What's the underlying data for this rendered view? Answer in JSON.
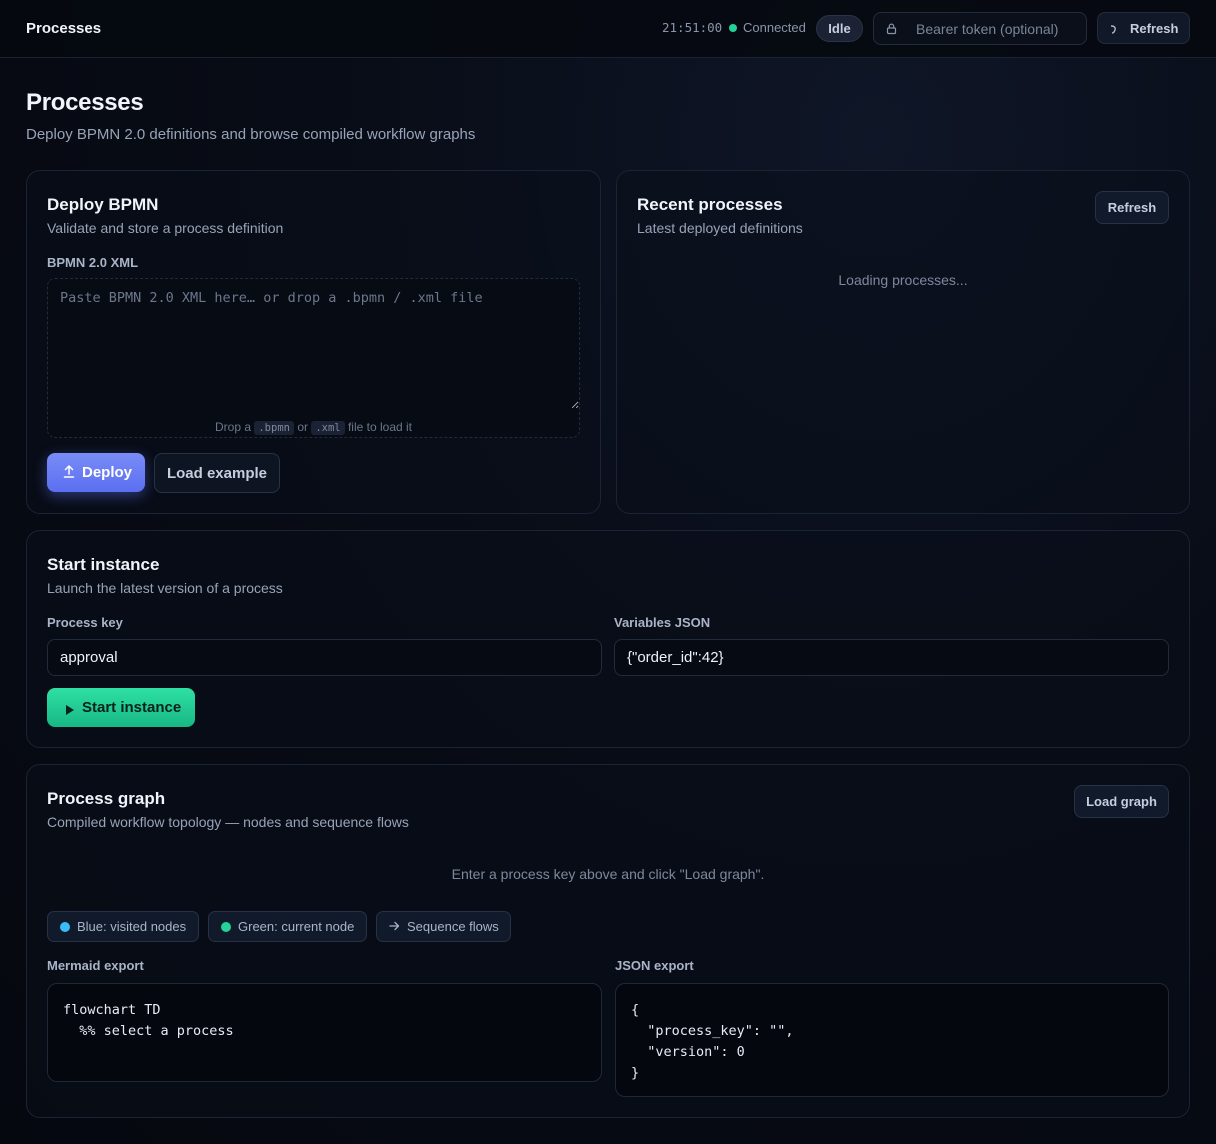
{
  "topbar": {
    "title": "Processes",
    "clock": "21:51:00",
    "connection_status": "Connected",
    "state_badge": "Idle",
    "token_placeholder": "Bearer token (optional)",
    "refresh_label": "Refresh",
    "icons": {
      "lock": "lock-icon",
      "refresh": "refresh-icon"
    },
    "status_color": "#22d39a"
  },
  "page": {
    "title": "Processes",
    "subtitle": "Deploy BPMN 2.0 definitions and browse compiled workflow graphs"
  },
  "deploy": {
    "title": "Deploy BPMN",
    "subtitle": "Validate and store a process definition",
    "xml_label": "BPMN 2.0 XML",
    "xml_placeholder": "Paste BPMN 2.0 XML here… or drop a .bpmn / .xml file",
    "drop_hint_prefix": "Drop a",
    "drop_hint_ext1": ".bpmn",
    "drop_hint_or": "or",
    "drop_hint_ext2": ".xml",
    "drop_hint_suffix": "file to load it",
    "deploy_label": "Deploy",
    "load_example_label": "Load example",
    "accent_color": "#5b6ff0"
  },
  "recent": {
    "title": "Recent processes",
    "subtitle": "Latest deployed definitions",
    "refresh_label": "Refresh",
    "loading_text": "Loading processes..."
  },
  "start": {
    "title": "Start instance",
    "subtitle": "Launch the latest version of a process",
    "process_key_label": "Process key",
    "process_key_value": "approval",
    "variables_label": "Variables JSON",
    "variables_value": "{\"order_id\":42}",
    "start_label": "Start instance",
    "accent_color": "#22d39a"
  },
  "graph": {
    "title": "Process graph",
    "subtitle": "Compiled workflow topology — nodes and sequence flows",
    "load_label": "Load graph",
    "empty_text": "Enter a process key above and click \"Load graph\".",
    "legend": [
      {
        "label": "Blue: visited nodes",
        "color": "#38bdf8"
      },
      {
        "label": "Green: current node",
        "color": "#22d39a"
      },
      {
        "label": "Sequence flows",
        "icon": "arrow-right-icon"
      }
    ],
    "mermaid_label": "Mermaid export",
    "mermaid_code": "flowchart TD\n  %% select a process",
    "json_label": "JSON export",
    "json_code": "{\n  \"process_key\": \"\",\n  \"version\": 0\n}"
  }
}
